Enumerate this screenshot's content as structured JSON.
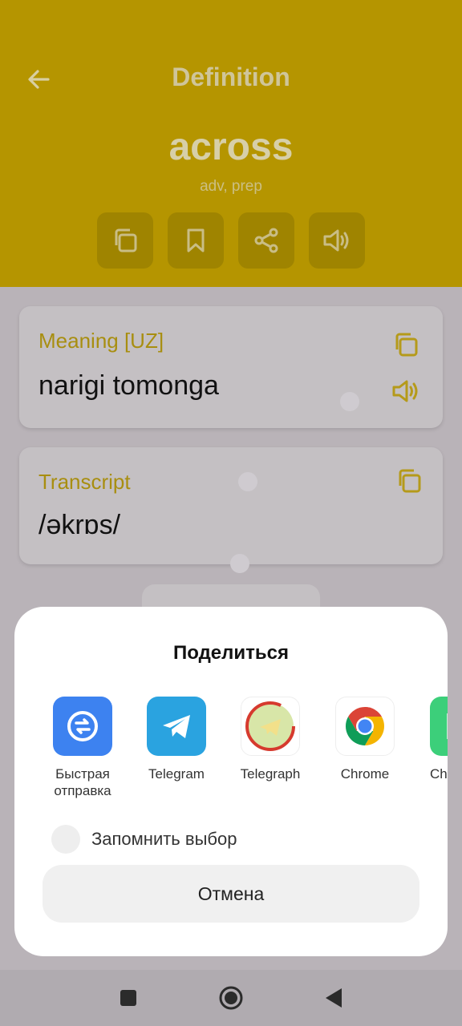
{
  "header": {
    "title": "Definition",
    "word": "across",
    "part_of_speech": "adv, prep",
    "actions": [
      "copy-icon",
      "bookmark-icon",
      "share-icon",
      "speaker-icon"
    ]
  },
  "meaning": {
    "label": "Meaning [UZ]",
    "value": "narigi tomonga"
  },
  "transcript": {
    "label": "Transcript",
    "value": "/əkrɒs/"
  },
  "share_sheet": {
    "title": "Поделиться",
    "apps": [
      {
        "label": "Быстрая отправка",
        "icon": "quick-send-icon"
      },
      {
        "label": "Telegram",
        "icon": "telegram-icon"
      },
      {
        "label": "Telegraph",
        "icon": "telegraph-icon"
      },
      {
        "label": "Chrome",
        "icon": "chrome-icon"
      },
      {
        "label": "Ches a",
        "icon": "chess-app-icon"
      }
    ],
    "remember_label": "Запомнить выбор",
    "cancel_label": "Отмена"
  },
  "colors": {
    "header_bg": "#b59500",
    "accent": "#a88e10",
    "sheet_bg": "#ffffff"
  }
}
